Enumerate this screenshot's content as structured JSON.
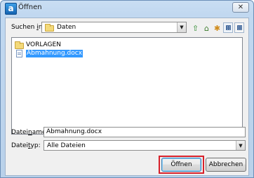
{
  "window": {
    "title": "Öffnen",
    "app_icon_letter": "a",
    "close_glyph": "✕"
  },
  "look_in": {
    "label_prefix": "Suchen ",
    "label_accel": "i",
    "label_suffix": "n:",
    "value": "Daten"
  },
  "toolbar": {
    "icons": [
      "up-folder-icon",
      "desktop-home-icon",
      "new-folder-icon",
      "list-view-icon",
      "details-view-icon"
    ]
  },
  "files": [
    {
      "name": "VORLAGEN",
      "type": "folder",
      "selected": false
    },
    {
      "name": "Abmahnung.docx",
      "type": "document",
      "selected": true
    }
  ],
  "filename": {
    "label_prefix": "Datei",
    "label_accel": "n",
    "label_suffix": "ame:",
    "value": "Abmahnung.docx"
  },
  "filetype": {
    "label_prefix": "Datei",
    "label_accel": "t",
    "label_suffix": "yp:",
    "value": "Alle Dateien"
  },
  "buttons": {
    "open_label": "Öffnen",
    "cancel_label": "Abbrechen"
  },
  "colors": {
    "selection": "#3399ff",
    "highlight_box": "#d7202a"
  }
}
